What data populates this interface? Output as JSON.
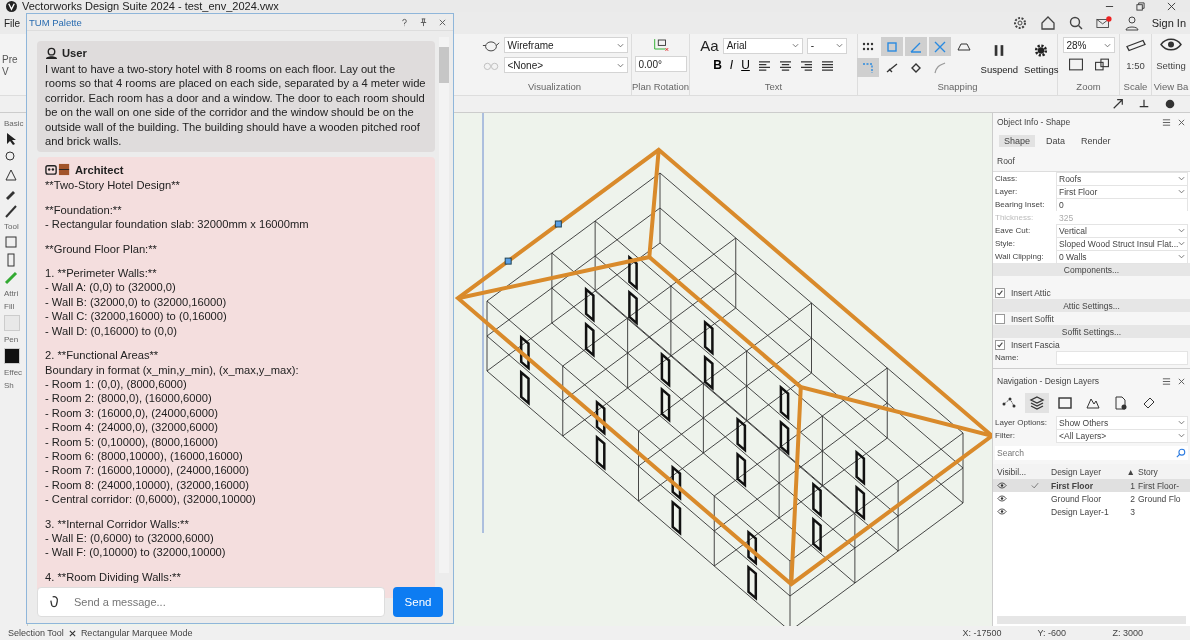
{
  "app": {
    "title": "Vectorworks Design Suite 2024 - test_env_2024.vwx",
    "menu": [
      "File"
    ],
    "sign_in": "Sign In",
    "notification": true
  },
  "ribbon": {
    "left_labels": [
      "Pre",
      "V"
    ],
    "visualization": {
      "render_mode": "Wireframe",
      "light": "<None>",
      "label": "Visualization"
    },
    "plan_rotation": {
      "value": "0.00°",
      "label": "Plan Rotation"
    },
    "text": {
      "aa": "Aa",
      "font": "Arial",
      "size": "-",
      "format": [
        "B",
        "I",
        "U"
      ],
      "label": "Text"
    },
    "snapping": {
      "buttons": [
        {
          "kind": "grid",
          "on": false
        },
        {
          "kind": "object",
          "on": true
        },
        {
          "kind": "angle",
          "on": true
        },
        {
          "kind": "intersection",
          "on": true
        },
        {
          "kind": "face",
          "on": false
        },
        {
          "kind": "edge",
          "on": true
        },
        {
          "kind": "distance",
          "on": false
        },
        {
          "kind": "constraint",
          "on": false
        },
        {
          "kind": "tangent",
          "on": false
        }
      ],
      "suspend": "Suspend",
      "settings": "Settings",
      "label": "Snapping"
    },
    "zoom": {
      "value": "28%",
      "label": "Zoom"
    },
    "scale": {
      "value": "1:50",
      "label": "Scale"
    },
    "view_bar": {
      "settings": "Setting",
      "label": "View Ba"
    }
  },
  "tool_strip": {
    "sections": [
      "Basic",
      "Tool",
      "Attri"
    ],
    "fill": "Fill",
    "pen": "Pen",
    "effects": "Effec",
    "shadow": "Sh"
  },
  "palette": {
    "title": "TUM Palette",
    "messages": [
      {
        "kind": "user",
        "author": "User",
        "blocks": [
          [
            "I want to have a two-story hotel with 8 rooms on each floor. Lay out the rooms so that 4 rooms are placed on each side, separated by a 4 meter wide corridor. Each room has a door and a window. The door to each room should be on the wall on one side of the corridor and the window should be on the outside wall of the building. The building should have a wooden pitched roof and brick walls."
          ]
        ]
      },
      {
        "kind": "architect",
        "author": "Architect",
        "blocks": [
          [
            "**Two-Story Hotel Design**"
          ],
          [
            "**Foundation:**",
            "- Rectangular foundation slab: 32000mm x 16000mm"
          ],
          [
            "**Ground Floor Plan:**"
          ],
          [
            "1. **Perimeter Walls:**",
            "- Wall A: (0,0) to (32000,0)",
            "- Wall B: (32000,0) to (32000,16000)",
            "- Wall C: (32000,16000) to (0,16000)",
            "- Wall D: (0,16000) to (0,0)"
          ],
          [
            "2. **Functional Areas**",
            "Boundary in format (x_min,y_min), (x_max,y_max):",
            "- Room 1: (0,0), (8000,6000)",
            "- Room 2: (8000,0), (16000,6000)",
            "- Room 3: (16000,0), (24000,6000)",
            "- Room 4: (24000,0), (32000,6000)",
            "- Room 5: (0,10000), (8000,16000)",
            "- Room 6: (8000,10000), (16000,16000)",
            "- Room 7: (16000,10000), (24000,16000)",
            "- Room 8: (24000,10000), (32000,16000)",
            "- Central corridor: (0,6000), (32000,10000)"
          ],
          [
            "3. **Internal Corridor Walls:**",
            "- Wall E: (0,6000) to (32000,6000)",
            "- Wall F: (0,10000) to (32000,10000)"
          ],
          [
            "4. **Room Dividing Walls:**"
          ]
        ]
      }
    ],
    "input": {
      "placeholder": "Send a message..."
    },
    "send": "Send"
  },
  "object_info": {
    "title": "Object Info - Shape",
    "tabs": [
      {
        "label": "Shape",
        "selected": true
      },
      {
        "label": "Data",
        "selected": false
      },
      {
        "label": "Render",
        "selected": false
      }
    ],
    "object_type": "Roof",
    "fields": [
      {
        "label": "Class:",
        "value": "Roofs",
        "kind": "dropdown",
        "disabled": false
      },
      {
        "label": "Layer:",
        "value": "First Floor",
        "kind": "dropdown",
        "disabled": false
      },
      {
        "label": "Bearing Inset:",
        "value": "0",
        "kind": "text",
        "disabled": false
      },
      {
        "label": "Thickness:",
        "value": "325",
        "kind": "text",
        "disabled": true
      },
      {
        "label": "Eave Cut:",
        "value": "Vertical",
        "kind": "dropdown",
        "disabled": false
      },
      {
        "label": "Style:",
        "value": "Sloped Wood Struct Insul Flat...",
        "kind": "dropdown",
        "disabled": false
      },
      {
        "label": "Wall Clipping:",
        "value": "0 Walls",
        "kind": "dropdown",
        "disabled": false
      }
    ],
    "components": "Components...",
    "options": [
      {
        "label": "Insert Attic",
        "checked": true,
        "button": "Attic Settings..."
      },
      {
        "label": "Insert Soffit",
        "checked": false,
        "button": "Soffit Settings..."
      },
      {
        "label": "Insert Fascia",
        "checked": true
      }
    ],
    "name_label": "Name:"
  },
  "navigation": {
    "title": "Navigation - Design Layers",
    "tabs": [
      {
        "kind": "network",
        "selected": false
      },
      {
        "kind": "layers",
        "selected": true
      },
      {
        "kind": "sheet",
        "selected": false
      },
      {
        "kind": "viewport",
        "selected": false
      },
      {
        "kind": "file",
        "selected": false
      },
      {
        "kind": "reference",
        "selected": false
      }
    ],
    "layer_options": {
      "label": "Layer Options:",
      "value": "Show Others"
    },
    "filter": {
      "label": "Filter:",
      "value": "<All Layers>"
    },
    "search": {
      "placeholder": "Search"
    },
    "columns": [
      "Visibil...",
      "Design Layer",
      "▲",
      "Story"
    ],
    "layers": [
      {
        "visible": true,
        "active": true,
        "selected": true,
        "name": "First Floor",
        "number": "1",
        "story": "First Floor-"
      },
      {
        "visible": true,
        "active": false,
        "selected": false,
        "name": "Ground Floor",
        "number": "2",
        "story": "Ground Flo"
      },
      {
        "visible": true,
        "active": false,
        "selected": false,
        "name": "Design Layer-1",
        "number": "3"
      }
    ]
  },
  "status": {
    "tool": "Selection Tool",
    "mode": "Rectangular Marquee Mode",
    "x": "X: -17500",
    "y": "Y: -600",
    "z": "Z: 3000"
  }
}
